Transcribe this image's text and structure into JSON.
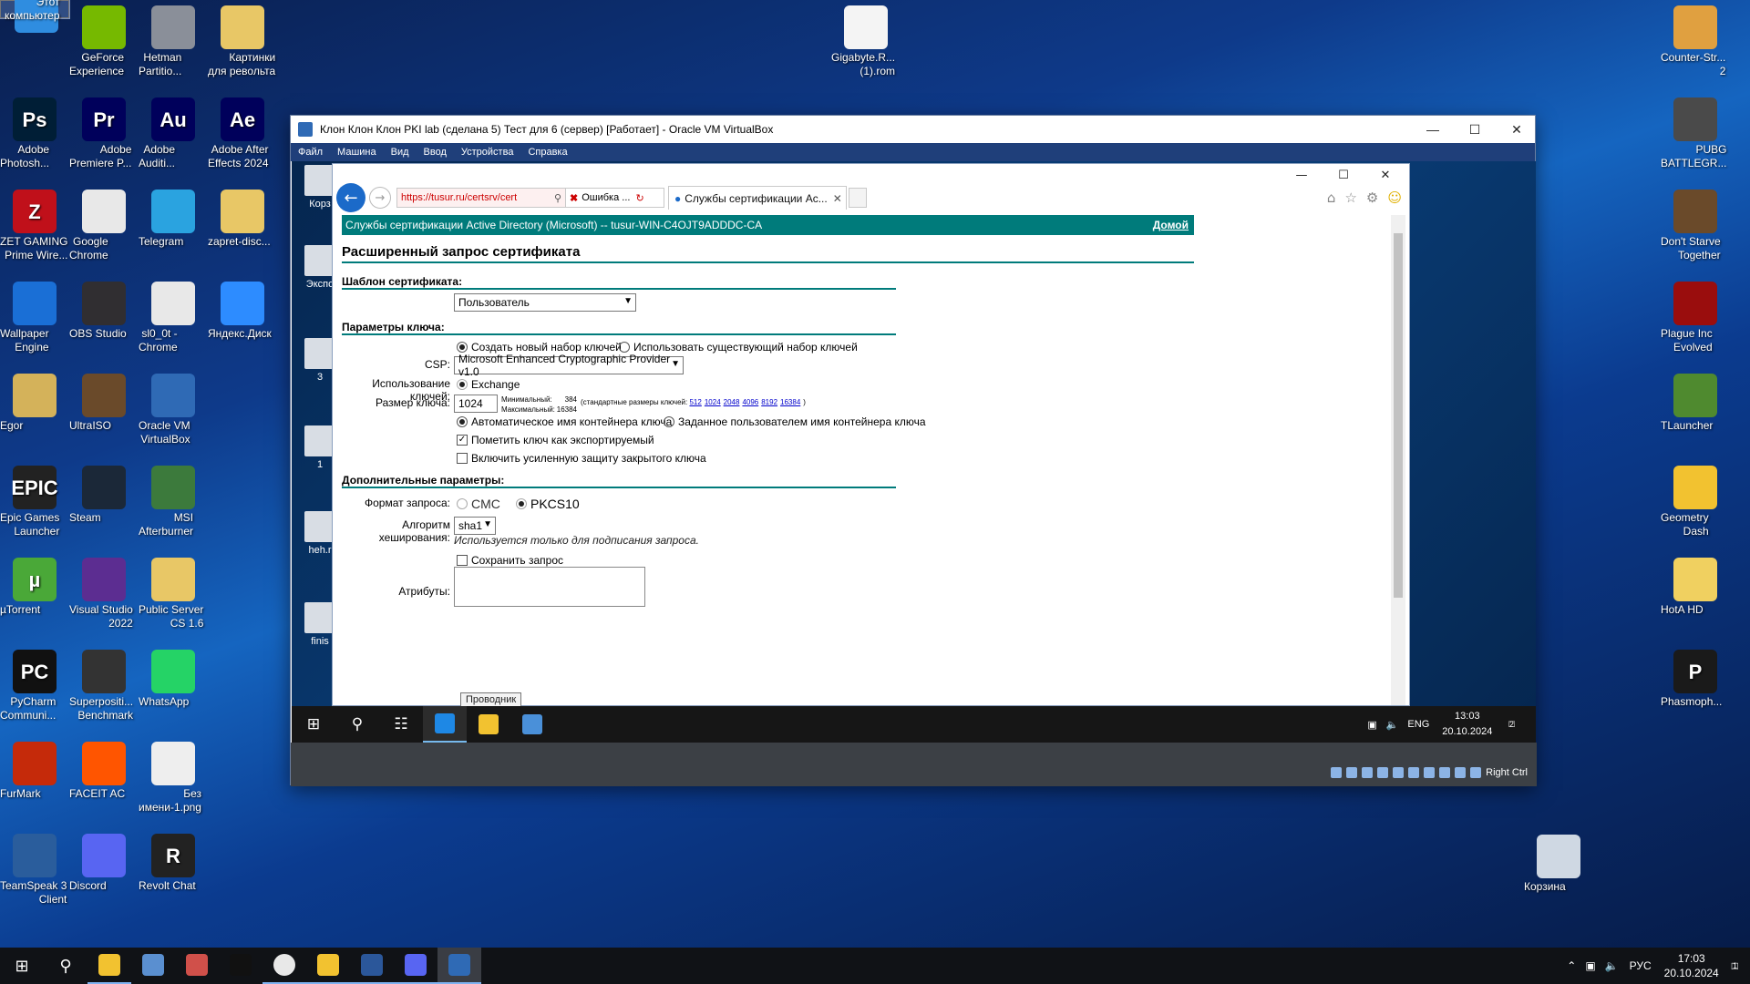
{
  "desktop": {
    "col1": [
      {
        "label": "Этот\nкомпьютер",
        "color": "#2f8de0",
        "glyph": ""
      },
      {
        "label": "Adobe\nPhotosh...",
        "color": "#001e36",
        "glyph": "Ps"
      },
      {
        "label": "ZET GAMING\nPrime Wire...",
        "color": "#c0101a",
        "glyph": "Z"
      },
      {
        "label": "Wallpaper\nEngine",
        "color": "#1a6fd6",
        "glyph": ""
      },
      {
        "label": "Egor",
        "color": "#d4b25a",
        "glyph": ""
      },
      {
        "label": "Epic Games\nLauncher",
        "color": "#222222",
        "glyph": "EPIC"
      },
      {
        "label": "µTorrent",
        "color": "#4aa838",
        "glyph": "µ"
      },
      {
        "label": "PyCharm\nCommuni...",
        "color": "#111111",
        "glyph": "PC"
      },
      {
        "label": "FurMark",
        "color": "#c52a0a",
        "glyph": ""
      },
      {
        "label": "TeamSpeak 3\nClient",
        "color": "#2a5d9c",
        "glyph": ""
      }
    ],
    "col2": [
      {
        "label": "GeForce\nExperience",
        "color": "#76b900",
        "glyph": ""
      },
      {
        "label": "Adobe\nPremiere P...",
        "color": "#00005b",
        "glyph": "Pr"
      },
      {
        "label": "Google\nChrome",
        "color": "#e8e8e8",
        "glyph": ""
      },
      {
        "label": "OBS Studio",
        "color": "#302e31",
        "glyph": ""
      },
      {
        "label": "UltraISO",
        "color": "#6a4a2a",
        "glyph": ""
      },
      {
        "label": "Steam",
        "color": "#1b2838",
        "glyph": ""
      },
      {
        "label": "Visual Studio\n2022",
        "color": "#5c2d91",
        "glyph": ""
      },
      {
        "label": "Superpositi...\nBenchmark",
        "color": "#333333",
        "glyph": ""
      },
      {
        "label": "FACEIT AC",
        "color": "#ff5500",
        "glyph": ""
      },
      {
        "label": "Discord",
        "color": "#5865f2",
        "glyph": ""
      }
    ],
    "col3": [
      {
        "label": "Hetman\nPartitio...",
        "color": "#8a8f99",
        "glyph": ""
      },
      {
        "label": "Adobe\nAuditi...",
        "color": "#00005b",
        "glyph": "Au"
      },
      {
        "label": "Telegram",
        "color": "#2aa3e0",
        "glyph": ""
      },
      {
        "label": "sl0_0t -\nChrome",
        "color": "#e8e8e8",
        "glyph": ""
      },
      {
        "label": "Oracle VM\nVirtualBox",
        "color": "#2f6ab5",
        "glyph": ""
      },
      {
        "label": "MSI\nAfterburner",
        "color": "#3c7a3c",
        "glyph": ""
      },
      {
        "label": "Public Server\nCS 1.6",
        "color": "#e8c766",
        "glyph": ""
      },
      {
        "label": "WhatsApp",
        "color": "#25d366",
        "glyph": ""
      },
      {
        "label": "Без\nимени-1.png",
        "color": "#eeeeee",
        "glyph": ""
      },
      {
        "label": "Revolt Chat",
        "color": "#222222",
        "glyph": "R"
      }
    ],
    "col4": [
      {
        "label": "Картинки\nдля револьта",
        "color": "#e8c766",
        "glyph": ""
      },
      {
        "label": "Adobe After\nEffects 2024",
        "color": "#00005b",
        "glyph": "Ae"
      },
      {
        "label": "zapret-disc...",
        "color": "#e8c766",
        "glyph": ""
      },
      {
        "label": "Яндекс.Диск",
        "color": "#2d8cff",
        "glyph": ""
      }
    ],
    "middle": {
      "label": "Gigabyte.R...\n(1).rom",
      "color": "#f4f4f4"
    },
    "right": [
      {
        "label": "Counter-Str...\n2",
        "color": "#e0a040",
        "glyph": ""
      },
      {
        "label": "PUBG\nBATTLEGR...",
        "color": "#4a4a4a",
        "glyph": ""
      },
      {
        "label": "Don't Starve\nTogether",
        "color": "#6a4a2a",
        "glyph": ""
      },
      {
        "label": "Plague Inc\nEvolved",
        "color": "#9a0d0d",
        "glyph": ""
      },
      {
        "label": "TLauncher",
        "color": "#4f8a2f",
        "glyph": ""
      },
      {
        "label": "Geometry\nDash",
        "color": "#f2c230",
        "glyph": ""
      },
      {
        "label": "HotA HD",
        "color": "#f0d060",
        "glyph": ""
      },
      {
        "label": "Phasmoph...",
        "color": "#1a1a1a",
        "glyph": "P"
      }
    ],
    "recycle": {
      "label": "Корзина",
      "color": "#cfd8e3"
    }
  },
  "vbox": {
    "title": "Клон Клон Клон PKI lab (сделана 5) Тест для 6 (сервер) [Работает] - Oracle VM VirtualBox",
    "menu": [
      "Файл",
      "Машина",
      "Вид",
      "Ввод",
      "Устройства",
      "Справка"
    ],
    "host_key": "Right Ctrl",
    "guest_icons": [
      {
        "label": "Корз"
      },
      {
        "label": "Экспо"
      },
      {
        "label": "3"
      },
      {
        "label": "1"
      },
      {
        "label": "heh.r"
      },
      {
        "label": "finis"
      }
    ],
    "guest_taskbar": {
      "lang": "ENG",
      "time": "13:03",
      "date": "20.10.2024",
      "notif": "2",
      "tooltip": "Проводник"
    }
  },
  "ie": {
    "url": "https://tusur.ru/certsrv/cert",
    "error": "Ошибка ...",
    "tab": "Службы сертификации Ac...",
    "header": "Службы сертификации Active Directory (Microsoft)  --  tusur-WIN-C4OJT9ADDDC-CA",
    "header_brand": "Microsoft",
    "home": "Домой",
    "title": "Расширенный запрос сертификата",
    "sec_template": "Шаблон сертификата:",
    "template_value": "Пользователь",
    "sec_key": "Параметры ключа:",
    "radio_new": "Создать новый набор ключей",
    "radio_existing": "Использовать существующий набор ключей",
    "csp_label": "CSP:",
    "csp_value": "Microsoft Enhanced Cryptographic Provider v1.0",
    "usage_label": "Использование ключей:",
    "usage_value": "Exchange",
    "size_label": "Размер ключа:",
    "size_value": "1024",
    "min_label": "Минимальный:",
    "min_value": "384",
    "max_label": "Максимальный:",
    "max_value": "16384",
    "std_label": "(стандартные размеры ключей:",
    "std_sizes": [
      "512",
      "1024",
      "2048",
      "4096",
      "8192",
      "16384"
    ],
    "auto_container": "Автоматическое имя контейнера ключа",
    "user_container": "Заданное пользователем имя контейнера ключа",
    "exportable": "Пометить ключ как экспортируемый",
    "strong_protect": "Включить усиленную защиту закрытого ключа",
    "sec_extra": "Дополнительные параметры:",
    "format_label": "Формат запроса:",
    "format_cmc": "CMC",
    "format_pkcs": "PKCS10",
    "hash_label": "Алгоритм хеширования:",
    "hash_value": "sha1",
    "hash_note": "Используется только для подписания запроса.",
    "save_req": "Сохранить запрос",
    "attrs_label": "Атрибуты:"
  },
  "host_taskbar": {
    "lang": "РУС",
    "time": "17:03",
    "date": "20.10.2024",
    "notif": "1"
  }
}
